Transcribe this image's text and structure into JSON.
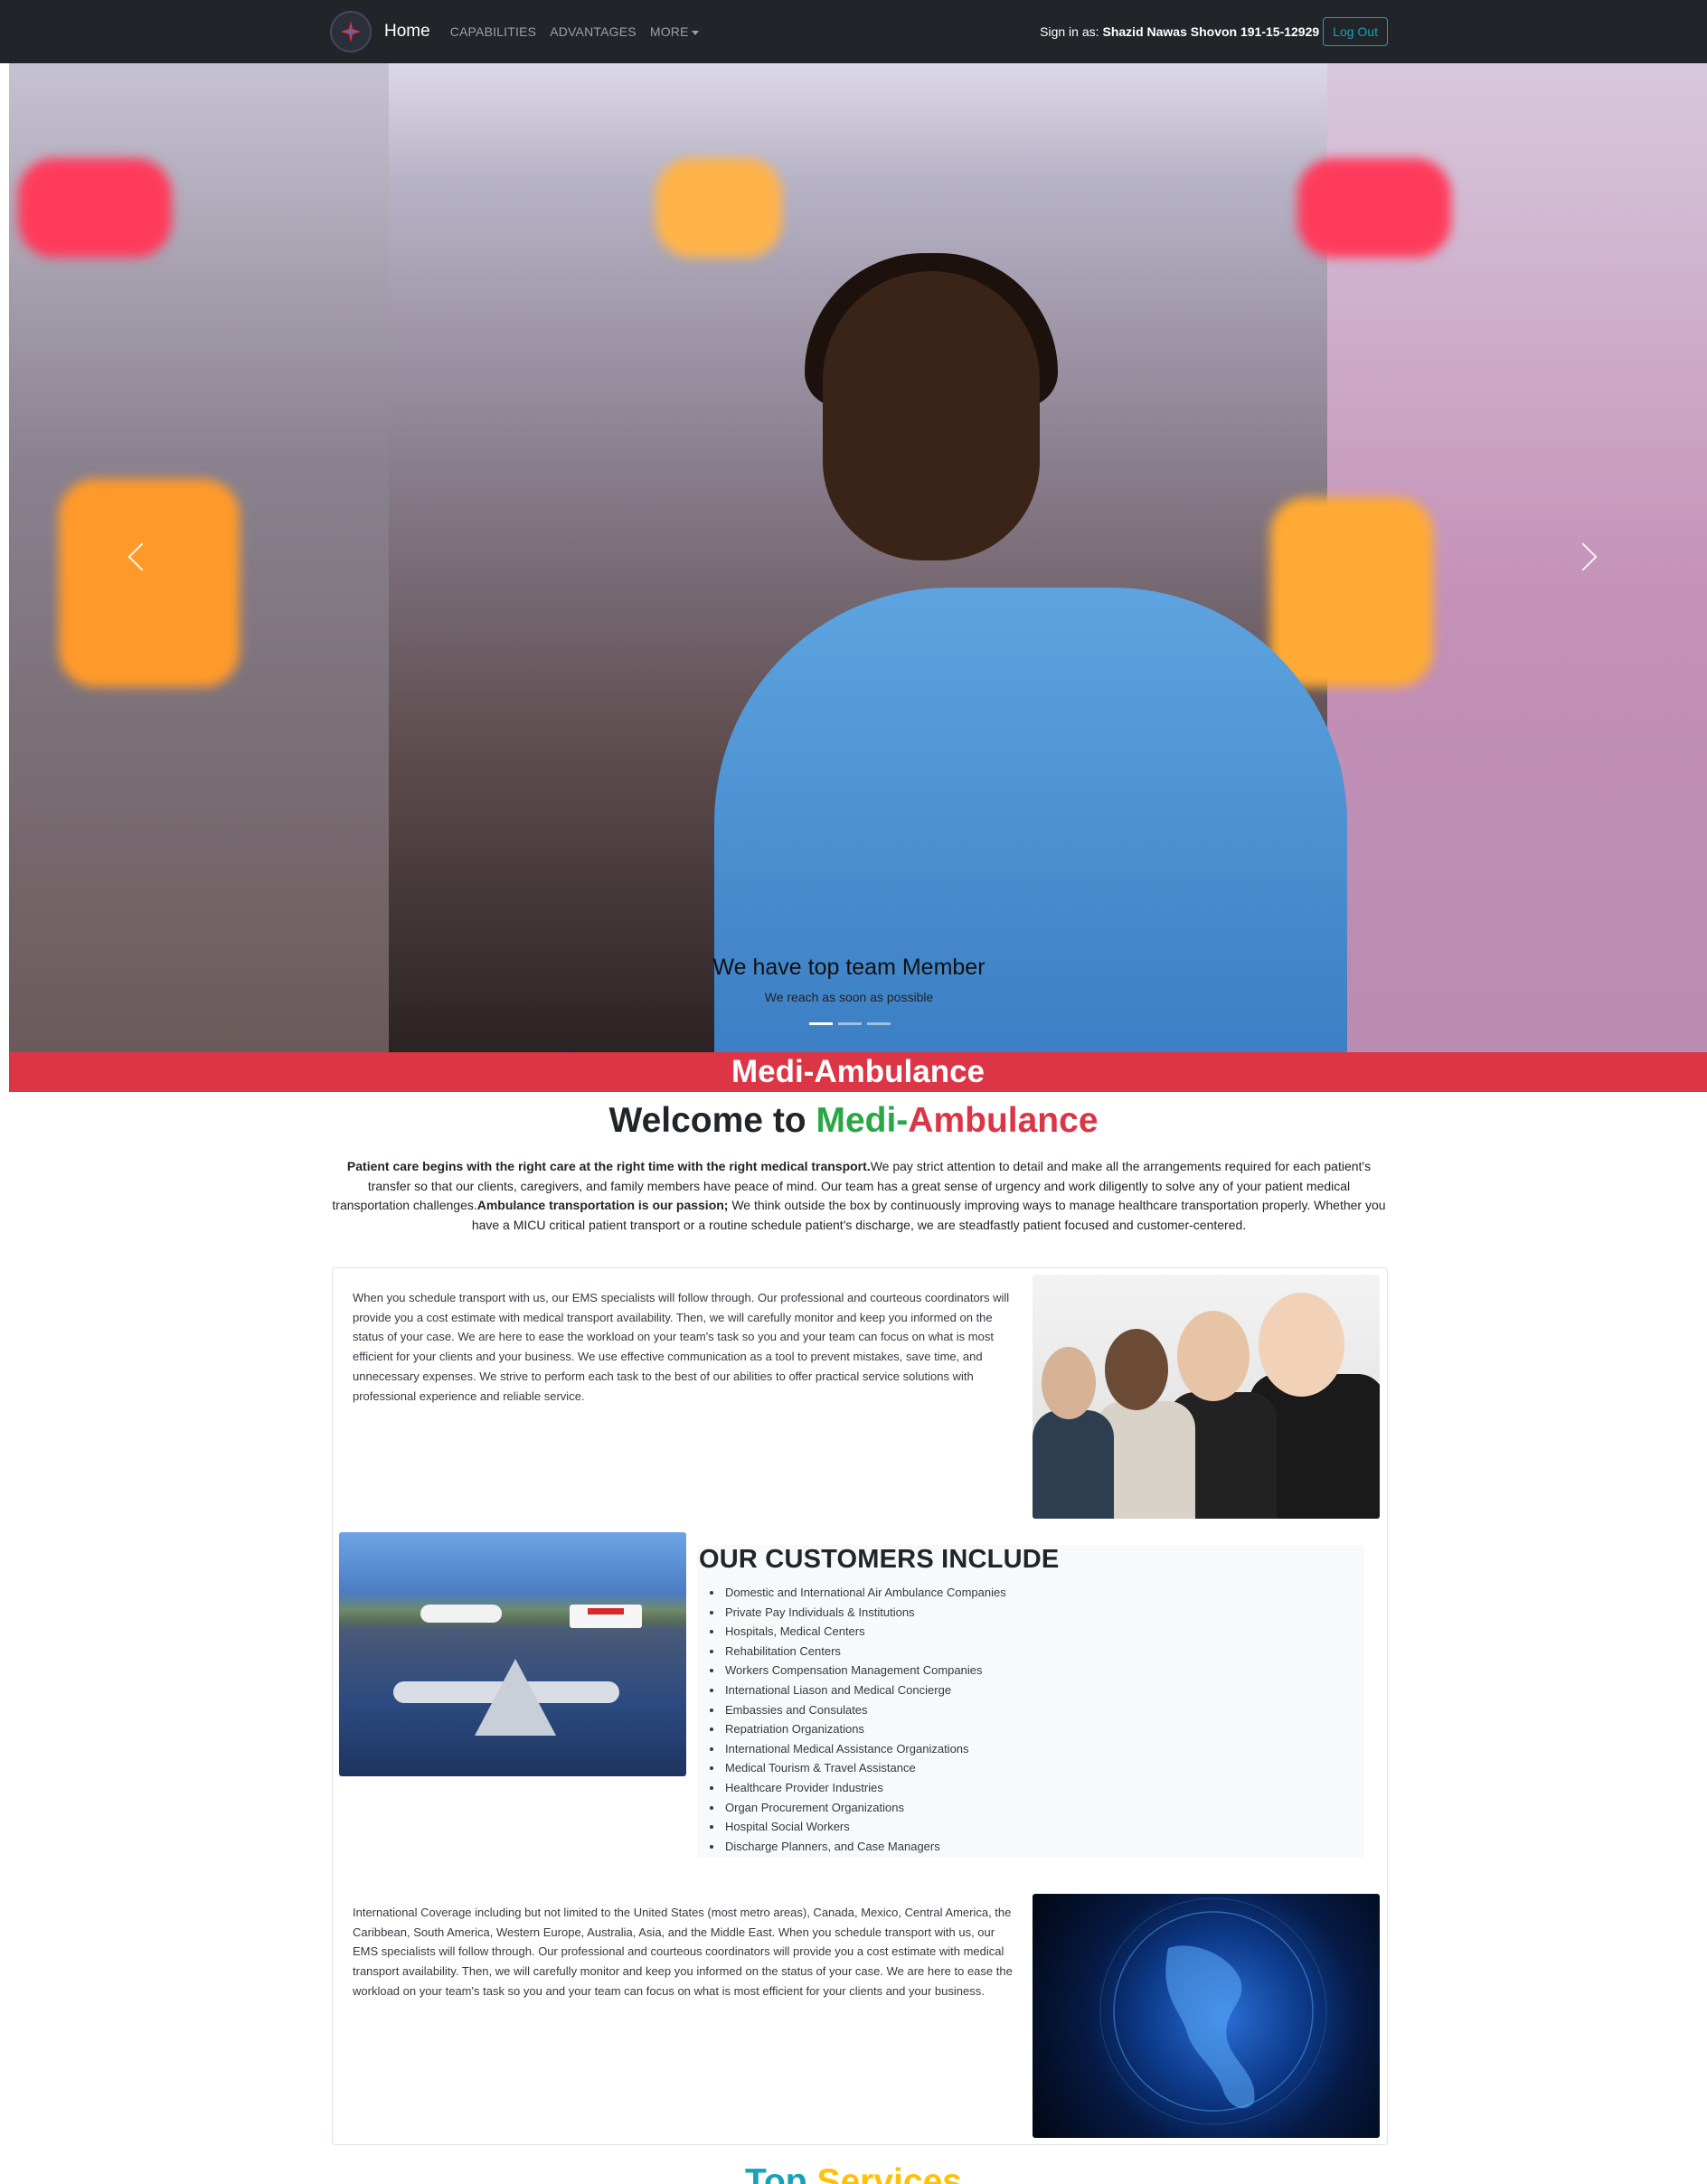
{
  "navbar": {
    "brand": "Home",
    "links": [
      "CAPABILITIES",
      "ADVANTAGES",
      "MORE"
    ],
    "signin_label": "Sign in as:",
    "signin_name": "Shazid Nawas Shovon 191-15-12929",
    "logout_label": "Log Out"
  },
  "hero": {
    "caption_title": "We have top team Member",
    "caption_sub": "We reach as soon as possible",
    "active_slide": 1,
    "slide_count": 3
  },
  "band": {
    "title": "Medi-Ambulance"
  },
  "welcome": {
    "prefix": "Welcome to ",
    "part1": "Medi-",
    "part2": "Ambulance"
  },
  "intro": {
    "bold1": "Patient care begins with the right care at the right time with the right medical transport.",
    "text1": "We pay strict attention to detail and make all the arrangements required for each patient's transfer so that our clients, caregivers, and family members have peace of mind. Our team has a great sense of urgency and work diligently to solve any of your patient medical transportation challenges.",
    "bold2": "Ambulance transportation is our passion;",
    "text2": " We think outside the box by continuously improving ways to manage healthcare transportation properly. Whether you have a MICU critical patient transport or a routine schedule patient's discharge, we are steadfastly patient focused and customer-centered."
  },
  "section1": {
    "text": "When you schedule transport with us, our EMS specialists will follow through. Our professional and courteous coordinators will provide you a cost estimate with medical transport availability. Then, we will carefully monitor and keep you informed on the status of your case. We are here to ease the workload on your team's task so you and your team can focus on what is most efficient for your clients and your business. We use effective communication as a tool to prevent mistakes, save time, and unnecessary expenses. We strive to perform each task to the best of our abilities to offer practical service solutions with professional experience and reliable service."
  },
  "customers": {
    "title": "OUR CUSTOMERS INCLUDE",
    "items": [
      "Domestic and International Air Ambulance Companies",
      "Private Pay Individuals & Institutions",
      "Hospitals, Medical Centers",
      "Rehabilitation Centers",
      "Workers Compensation Management Companies",
      "International Liason and Medical Concierge",
      "Embassies and Consulates",
      "Repatriation Organizations",
      "International Medical Assistance Organizations",
      "Medical Tourism & Travel Assistance",
      "Healthcare Provider Industries",
      "Organ Procurement Organizations",
      "Hospital Social Workers",
      "Discharge Planners, and Case Managers"
    ]
  },
  "section3": {
    "text": "International Coverage including but not limited to the United States (most metro areas), Canada, Mexico, Central America, the Caribbean, South America, Western Europe, Australia, Asia, and the Middle East. When you schedule transport with us, our EMS specialists will follow through. Our professional and courteous coordinators will provide you a cost estimate with medical transport availability. Then, we will carefully monitor and keep you informed on the status of your case. We are here to ease the workload on your team's task so you and your team can focus on what is most efficient for your clients and your business."
  },
  "top_services": {
    "part1": "Top ",
    "part2": "Services"
  },
  "colors": {
    "navbar": "#212529",
    "band": "#dc3545",
    "green": "#28a745",
    "red": "#dc3545",
    "info": "#17a2b8",
    "warning": "#ffc107"
  },
  "icons": {
    "logo": "ambulance-star-logo-icon",
    "prev": "chevron-left-icon",
    "next": "chevron-right-icon",
    "caret": "caret-down-icon"
  }
}
